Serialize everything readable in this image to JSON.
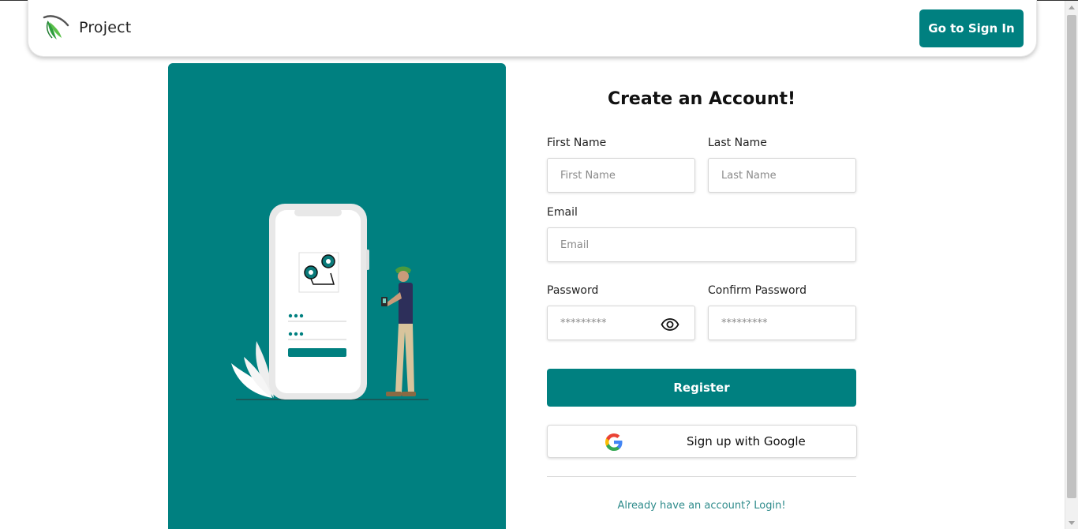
{
  "brand": {
    "name": "Project",
    "logo_icon": "feather-logo-icon"
  },
  "nav": {
    "signin_label": "Go to Sign In"
  },
  "form": {
    "title": "Create an Account!",
    "first_name": {
      "label": "First Name",
      "placeholder": "First Name",
      "value": ""
    },
    "last_name": {
      "label": "Last Name",
      "placeholder": "Last Name",
      "value": ""
    },
    "email": {
      "label": "Email",
      "placeholder": "Email",
      "value": ""
    },
    "password": {
      "label": "Password",
      "placeholder": "*********",
      "value": "",
      "toggle_icon": "eye-icon"
    },
    "confirm_password": {
      "label": "Confirm Password",
      "placeholder": "*********",
      "value": ""
    },
    "register_label": "Register",
    "google_label": "Sign up with Google",
    "google_icon": "google-icon",
    "login_text": "Already have an account? Login!"
  },
  "colors": {
    "accent": "#008080",
    "link": "#2e8b8b"
  }
}
